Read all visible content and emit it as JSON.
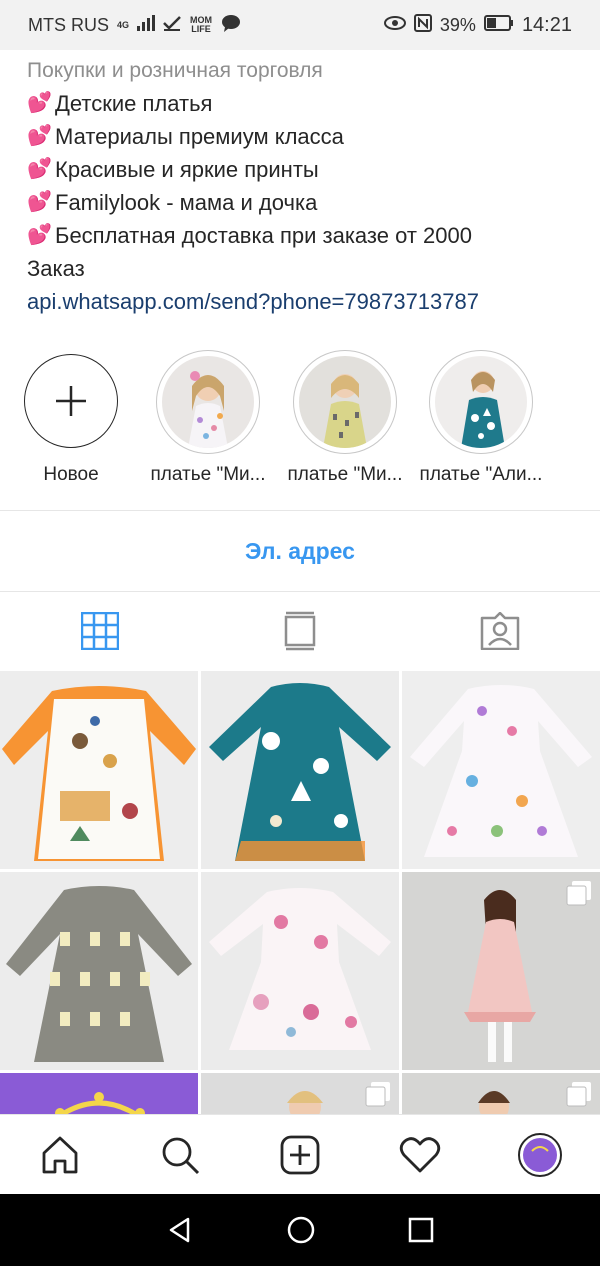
{
  "status_bar": {
    "carrier": "MTS RUS",
    "network": "4G",
    "app_badge": "MOM LIFE",
    "battery": "39%",
    "time": "14:21",
    "icons": [
      "signal-icon",
      "check-icon",
      "momlife-icon",
      "chat-icon",
      "eye-icon",
      "nfc-icon",
      "battery-icon"
    ]
  },
  "bio": {
    "category": "Покупки и розничная торговля",
    "lines": [
      "Детские платья",
      "Материалы премиум класса",
      "Красивые и яркие принты",
      "Familylook - мама и дочка",
      "Бесплатная доставка при заказе от 2000"
    ],
    "order_label": "Заказ",
    "link": "api.whatsapp.com/send?phone=79873713787"
  },
  "highlights": [
    {
      "label": "Новое"
    },
    {
      "label": "платье \"Ми..."
    },
    {
      "label": "платье \"Ми..."
    },
    {
      "label": "платье \"Али..."
    }
  ],
  "contact": {
    "email_label": "Эл. адрес"
  },
  "tabs": [
    "grid-icon",
    "feed-icon",
    "tagged-icon"
  ],
  "colors": {
    "accent": "#3897f0",
    "link": "#1a3e6e",
    "muted": "#8e8e8e",
    "heart": "#e0245e"
  },
  "grid_posts": [
    {
      "name": "post-orange-dress",
      "multi": false
    },
    {
      "name": "post-teal-dress",
      "multi": false
    },
    {
      "name": "post-white-print-dress",
      "multi": false
    },
    {
      "name": "post-grey-dress",
      "multi": false
    },
    {
      "name": "post-floral-dress",
      "multi": false
    },
    {
      "name": "post-girl-pink-dress",
      "multi": true
    },
    {
      "name": "post-purple-logo",
      "multi": false
    },
    {
      "name": "post-girl-photo-1",
      "multi": true
    },
    {
      "name": "post-girl-photo-2",
      "multi": true
    }
  ],
  "bottom_nav": [
    "home-icon",
    "search-icon",
    "add-post-icon",
    "activity-icon",
    "profile-avatar"
  ]
}
